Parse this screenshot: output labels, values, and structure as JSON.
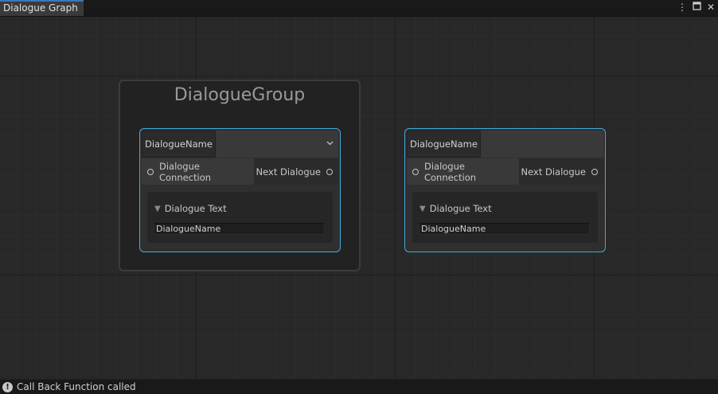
{
  "window": {
    "tab_title": "Dialogue Graph",
    "menu_icon": "kebab-menu-icon",
    "maximize_icon": "maximize-icon",
    "close_icon": "close-icon"
  },
  "graph": {
    "group": {
      "title": "DialogueGroup"
    },
    "nodes": [
      {
        "dialogue_name": "DialogueName",
        "input_port": "Dialogue Connection",
        "output_port": "Next Dialogue",
        "foldout_label": "Dialogue Text",
        "text_value": "DialogueName",
        "has_dropdown": true
      },
      {
        "dialogue_name": "DialogueName",
        "input_port": "Dialogue Connection",
        "output_port": "Next Dialogue",
        "foldout_label": "Dialogue Text",
        "text_value": "DialogueName",
        "has_dropdown": false
      }
    ]
  },
  "status": {
    "icon": "info-icon",
    "message": "Call Back Function called"
  },
  "colors": {
    "selection_outline": "#44a8e0",
    "tab_accent": "#3a79bb"
  }
}
